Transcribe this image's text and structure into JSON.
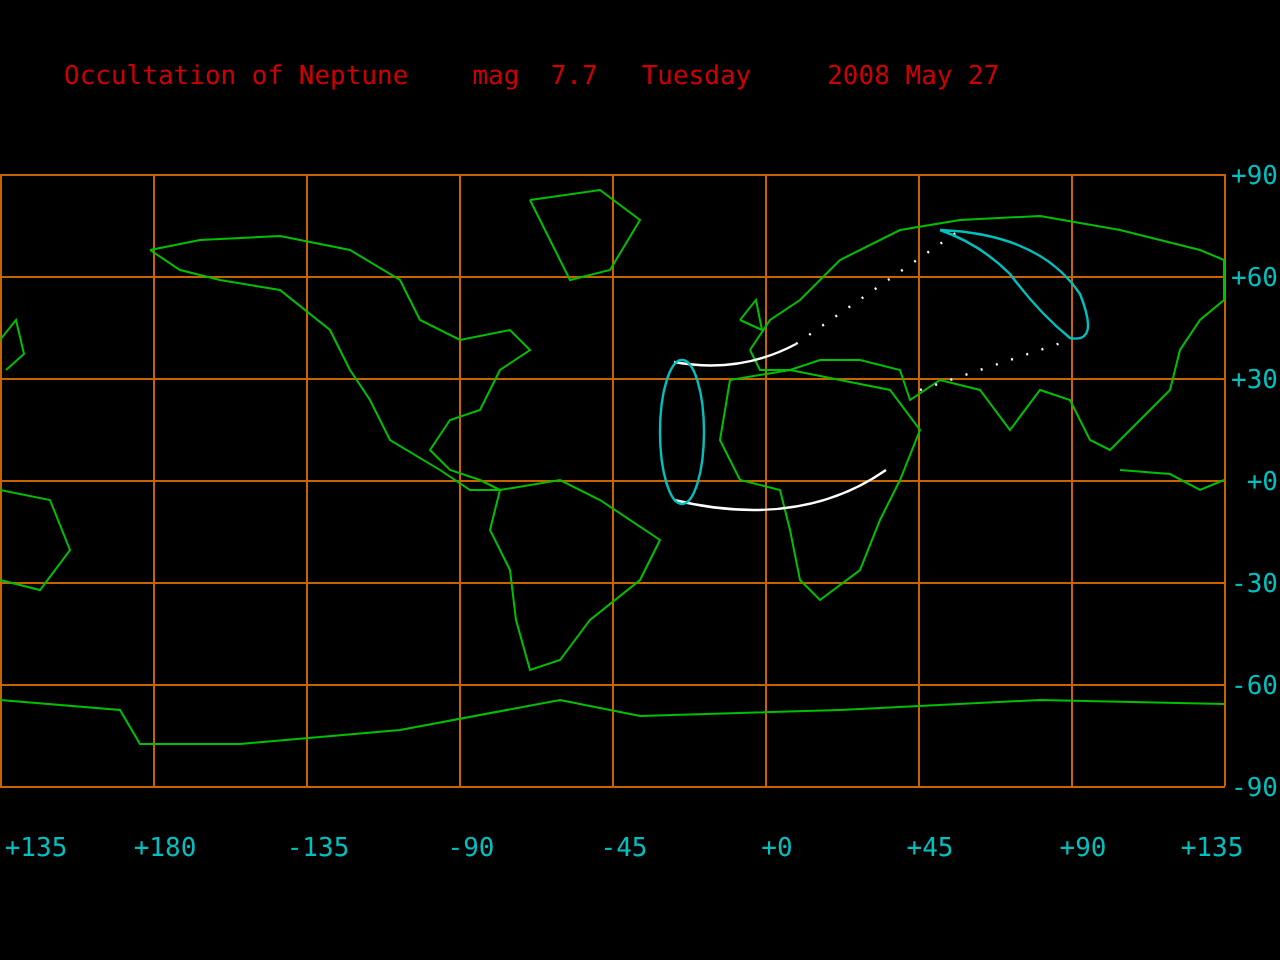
{
  "title": {
    "event": "Occultation of Neptune",
    "magnitude": "mag  7.7",
    "weekday": "Tuesday",
    "date": "2008 May 27"
  },
  "latitude_labels": [
    "+90",
    "+60",
    "+30",
    "+0",
    "-30",
    "-60",
    "-90"
  ],
  "longitude_labels": [
    "+135",
    "+180",
    "-135",
    "-90",
    "-45",
    "+0",
    "+45",
    "+90",
    "+135"
  ]
}
